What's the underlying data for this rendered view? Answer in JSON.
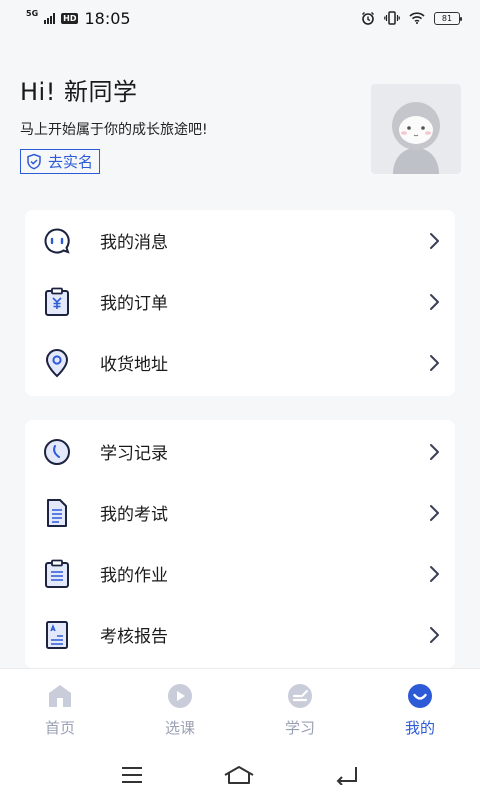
{
  "status_bar": {
    "network": "5G",
    "hd": "HD",
    "time": "18:05",
    "battery": "81"
  },
  "profile": {
    "greeting": "Hi! 新同学",
    "slogan": "马上开始属于你的成长旅途吧!",
    "realname_label": "去实名"
  },
  "menu_group_1": [
    {
      "label": "我的消息",
      "icon": "message-icon"
    },
    {
      "label": "我的订单",
      "icon": "order-icon"
    },
    {
      "label": "收货地址",
      "icon": "location-icon"
    }
  ],
  "menu_group_2": [
    {
      "label": "学习记录",
      "icon": "clock-icon"
    },
    {
      "label": "我的考试",
      "icon": "exam-icon"
    },
    {
      "label": "我的作业",
      "icon": "homework-icon"
    },
    {
      "label": "考核报告",
      "icon": "report-icon"
    }
  ],
  "tabbar": [
    {
      "label": "首页",
      "icon": "home-icon",
      "active": false
    },
    {
      "label": "选课",
      "icon": "play-icon",
      "active": false
    },
    {
      "label": "学习",
      "icon": "study-icon",
      "active": false
    },
    {
      "label": "我的",
      "icon": "profile-icon",
      "active": true
    }
  ],
  "colors": {
    "accent": "#2d5bd7",
    "icon_stroke": "#1c2340",
    "inactive": "#9aa0b4",
    "background": "#f6f7f9"
  }
}
